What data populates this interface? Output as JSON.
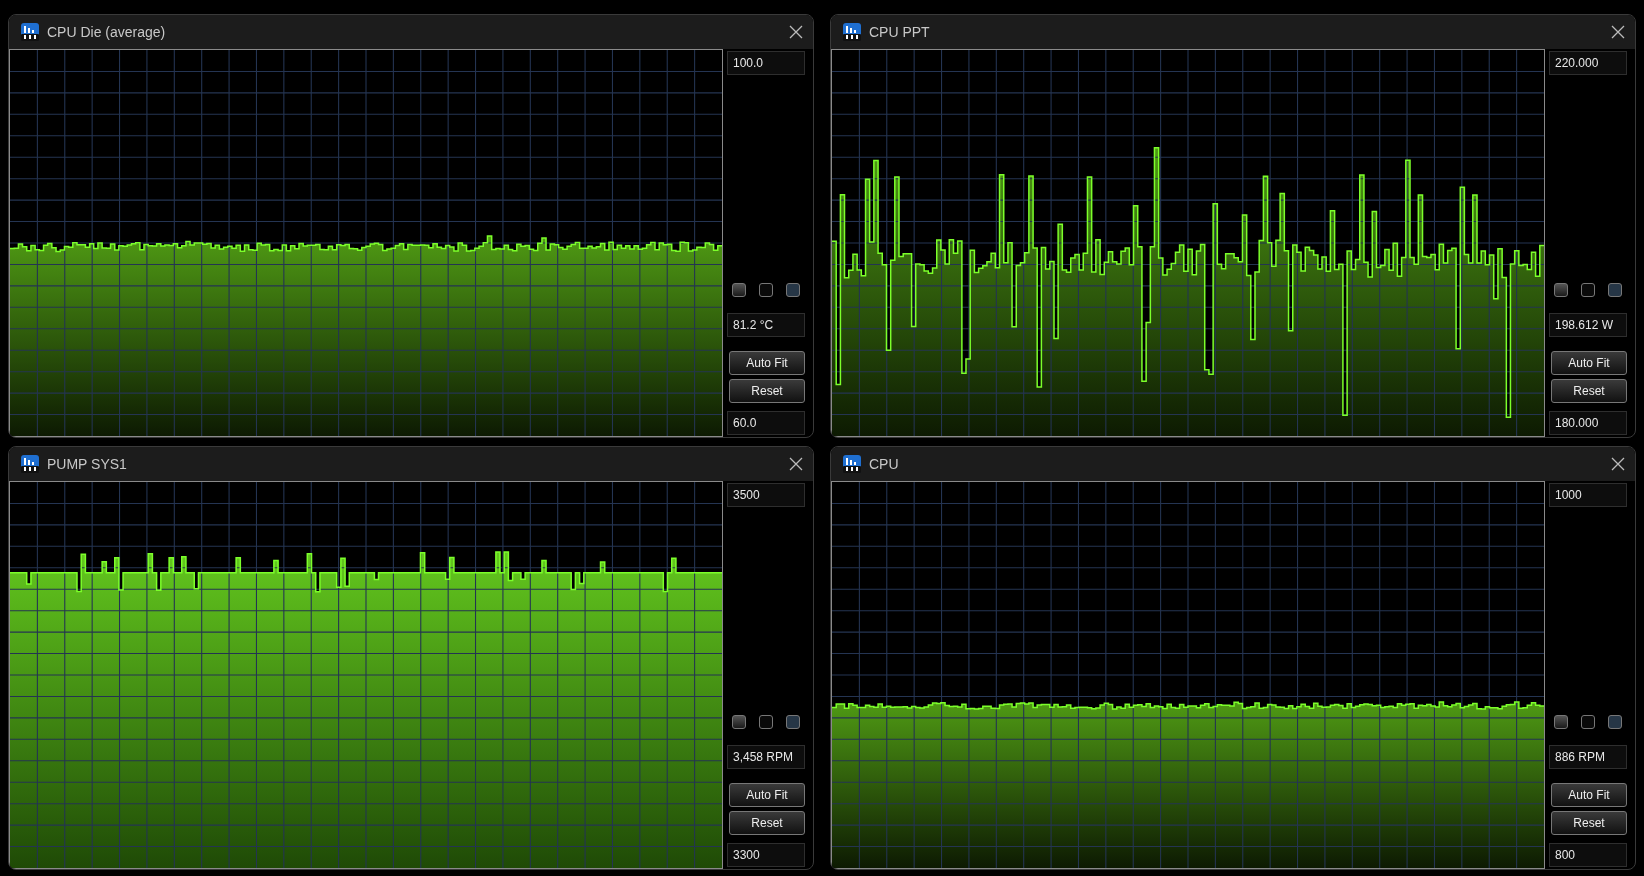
{
  "windows": [
    {
      "title": "CPU Die (average)",
      "max": "100.0",
      "value": "81.2 °C",
      "min": "60.0",
      "buttons": [
        "Auto Fit",
        "Reset"
      ]
    },
    {
      "title": "CPU PPT",
      "max": "220.000",
      "value": "198.612 W",
      "min": "180.000",
      "buttons": [
        "Auto Fit",
        "Reset"
      ]
    },
    {
      "title": "PUMP SYS1",
      "max": "3500",
      "value": "3,458 RPM",
      "min": "3300",
      "buttons": [
        "Auto Fit",
        "Reset"
      ]
    },
    {
      "title": "CPU",
      "max": "1000",
      "value": "886 RPM",
      "min": "800",
      "buttons": [
        "Auto Fit",
        "Reset"
      ]
    }
  ]
}
